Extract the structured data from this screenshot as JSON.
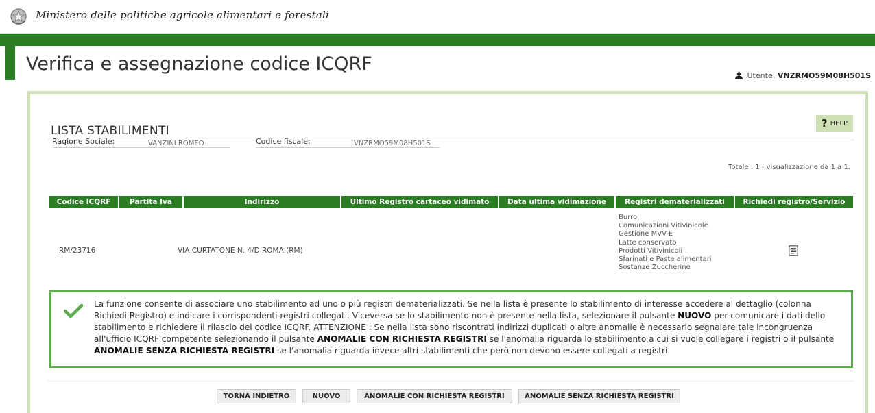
{
  "header": {
    "ministry": "Ministero delle politiche agricole alimentari e forestali",
    "page_title": "Verifica e assegnazione codice ICQRF",
    "user_label": "Utente:",
    "user_value": "VNZRMO59M08H501S",
    "help_label": "HELP"
  },
  "section": {
    "title": "LISTA STABILIMENTI",
    "ragione_label": "Ragione Sociale:",
    "ragione_value": "VANZINI ROMEO",
    "cf_label": "Codice fiscale:",
    "cf_value": "VNZRMO59M08H501S",
    "totale": "Totale : 1 - visualizzazione da 1 a 1."
  },
  "table": {
    "headers": [
      "Codice ICQRF",
      "Partita Iva",
      "Indirizzo",
      "Ultimo Registro cartaceo vidimato",
      "Data ultima vidimazione",
      "Registri dematerializzati",
      "Richiedi registro/Servizio"
    ],
    "row": {
      "codice": "RM/23716",
      "partita_iva": "",
      "indirizzo": "VIA CURTATONE N. 4/D ROMA (RM)",
      "ultimo_registro": "",
      "data_vidimazione": "",
      "registri": [
        "Burro",
        "Comunicazioni Vitivinicole",
        "Gestione MVV-E",
        "Latte conservato",
        "Prodotti Vitivinicoli",
        "Sfarinati e Paste alimentari",
        "Sostanze Zuccherine"
      ]
    }
  },
  "info": {
    "p1": "La funzione consente di associare uno stabilimento ad uno o più registri dematerializzati. Se nella lista è presente lo stabilimento di interesse accedere al dettaglio (colonna Richiedi Registro) e indicare i corrispondenti registri collegati. Viceversa se lo stabilimento non è presente nella lista, selezionare il pulsante ",
    "b1": "NUOVO",
    "p2": " per comunicare i dati dello stabilimento e richiedere il rilascio del codice ICQRF. ATTENZIONE : Se nella lista sono riscontrati indirizzi duplicati o altre anomalie è necessario segnalare tale incongruenza all'ufficio ICQRF competente selezionando il pulsante ",
    "b2": "ANOMALIE CON RICHIESTA REGISTRI",
    "p3": " se l'anomalia riguarda lo stabilimento a cui si vuole collegare i registri o il pulsante ",
    "b3": "ANOMALIE SENZA RICHIESTA REGISTRI",
    "p4": " se l'anomalia riguarda invece altri stabilimenti che però non devono essere collegati a registri."
  },
  "buttons": {
    "back": "TORNA INDIETRO",
    "new": "NUOVO",
    "anomalie_con": "ANOMALIE CON RICHIESTA REGISTRI",
    "anomalie_senza": "ANOMALIE SENZA RICHIESTA REGISTRI"
  },
  "colors": {
    "green": "#2a7d22",
    "light_green": "#cfe0b4",
    "info_border": "#5cab4d"
  }
}
